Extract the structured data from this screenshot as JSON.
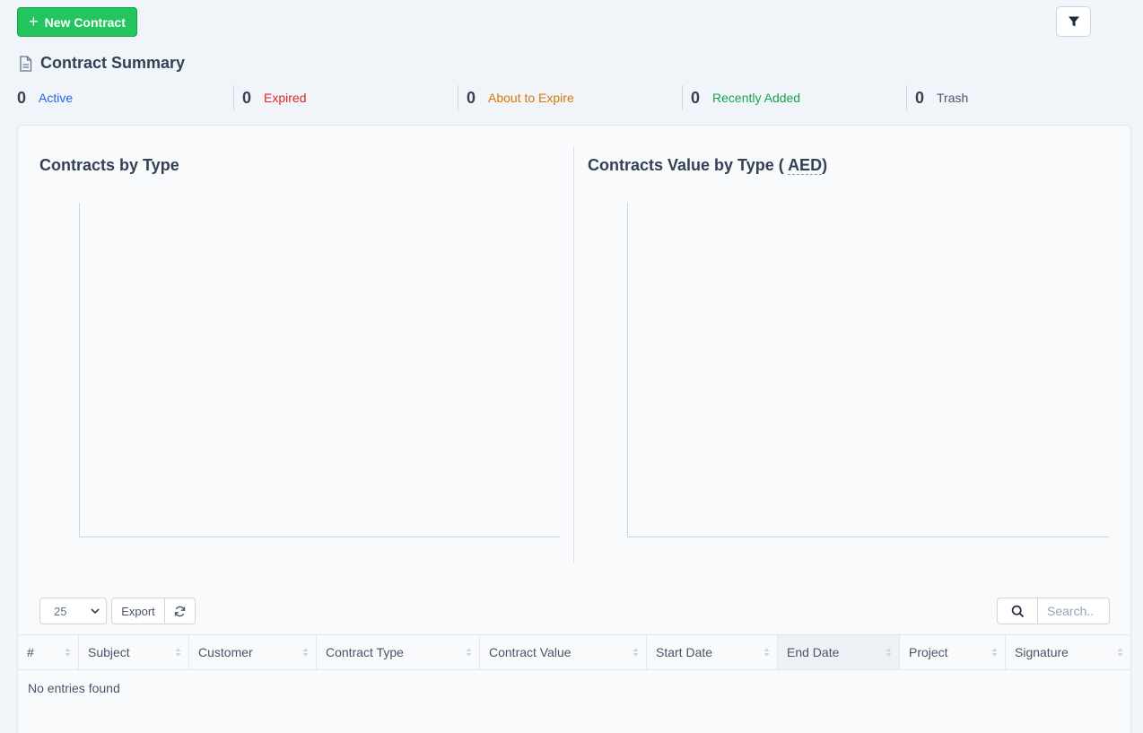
{
  "toolbar": {
    "new_contract_label": "New Contract"
  },
  "summary": {
    "title": "Contract Summary",
    "stats": [
      {
        "count": "0",
        "label": "Active",
        "color": "#2563eb"
      },
      {
        "count": "0",
        "label": "Expired",
        "color": "#dc2626"
      },
      {
        "count": "0",
        "label": "About to Expire",
        "color": "#d97706"
      },
      {
        "count": "0",
        "label": "Recently Added",
        "color": "#16a34a"
      },
      {
        "count": "0",
        "label": "Trash",
        "color": "#475569"
      }
    ]
  },
  "charts": {
    "left_title": "Contracts by Type",
    "right_title_prefix": "Contracts Value by Type ( ",
    "right_title_currency": "AED",
    "right_title_suffix": ")"
  },
  "table_controls": {
    "page_length": "25",
    "export_label": "Export",
    "search_placeholder": "Search.."
  },
  "table": {
    "columns": [
      "#",
      "Subject",
      "Customer",
      "Contract Type",
      "Contract Value",
      "Start Date",
      "End Date",
      "Project",
      "Signature"
    ],
    "sorted_column": "End Date",
    "empty_message": "No entries found"
  },
  "icons": {
    "plus": "plus-icon",
    "filter": "filter-icon",
    "document": "document-icon",
    "refresh": "refresh-icon",
    "search": "search-icon",
    "chevron": "chevron-down-icon",
    "sort": "sort-icon"
  }
}
